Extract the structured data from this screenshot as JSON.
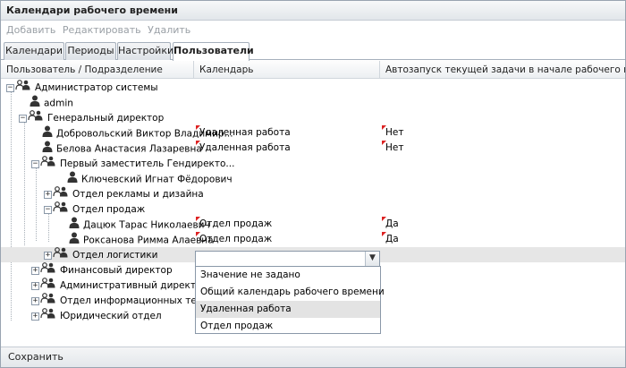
{
  "window": {
    "title": "Календари рабочего времени"
  },
  "toolbar": {
    "add": "Добавить",
    "edit": "Редактировать",
    "delete": "Удалить"
  },
  "tabs": [
    {
      "label": "Календари"
    },
    {
      "label": "Периоды"
    },
    {
      "label": "Настройки"
    },
    {
      "label": "Пользователи",
      "active": true
    }
  ],
  "columns": {
    "user": "Пользователь / Подразделение",
    "calendar": "Календарь",
    "autostart": "Автозапуск текущей задачи в начале рабочего интервала"
  },
  "rows": [
    {
      "label": "Администратор системы",
      "kind": "group",
      "expander": "−"
    },
    {
      "label": "admin",
      "kind": "user"
    },
    {
      "label": "Генеральный директор",
      "kind": "group",
      "expander": "−"
    },
    {
      "label": "Добровольский Виктор Владимир...",
      "kind": "user",
      "calendar": "Удаленная работа",
      "autostart": "Нет"
    },
    {
      "label": "Белова Анастасия Лазаревна",
      "kind": "user",
      "calendar": "Удаленная работа",
      "autostart": "Нет"
    },
    {
      "label": "Первый заместитель Гендиректо...",
      "kind": "group",
      "expander": "−"
    },
    {
      "label": "Ключевский Игнат Фёдорович",
      "kind": "user"
    },
    {
      "label": "Отдел рекламы и дизайна",
      "kind": "group",
      "expander": "+"
    },
    {
      "label": "Отдел продаж",
      "kind": "group",
      "expander": "−"
    },
    {
      "label": "Дацюк Тарас Николаевич",
      "kind": "user",
      "calendar": "Отдел продаж",
      "autostart": "Да"
    },
    {
      "label": "Роксанова Римма Алаевна",
      "kind": "user",
      "calendar": "Отдел продаж",
      "autostart": "Да"
    },
    {
      "label": "Отдел логистики",
      "kind": "group",
      "expander": "+",
      "selected": true
    },
    {
      "label": "Финансовый директор",
      "kind": "group",
      "expander": "+"
    },
    {
      "label": "Административный директор",
      "kind": "group",
      "expander": "+"
    },
    {
      "label": "Отдел информационных техноло...",
      "kind": "group",
      "expander": "+"
    },
    {
      "label": "Юридический отдел",
      "kind": "group",
      "expander": "+"
    }
  ],
  "calendar_dropdown": {
    "value": "",
    "options": [
      {
        "label": "Значение не задано"
      },
      {
        "label": "Общий календарь рабочего времени"
      },
      {
        "label": "Удаленная работа",
        "hovered": true
      },
      {
        "label": "Отдел продаж"
      }
    ]
  },
  "footer": {
    "save": "Сохранить"
  },
  "colors": {
    "dirty_marker": "#dd2222",
    "selection": "#e6e6e6",
    "hover": "#e3e3e3"
  }
}
